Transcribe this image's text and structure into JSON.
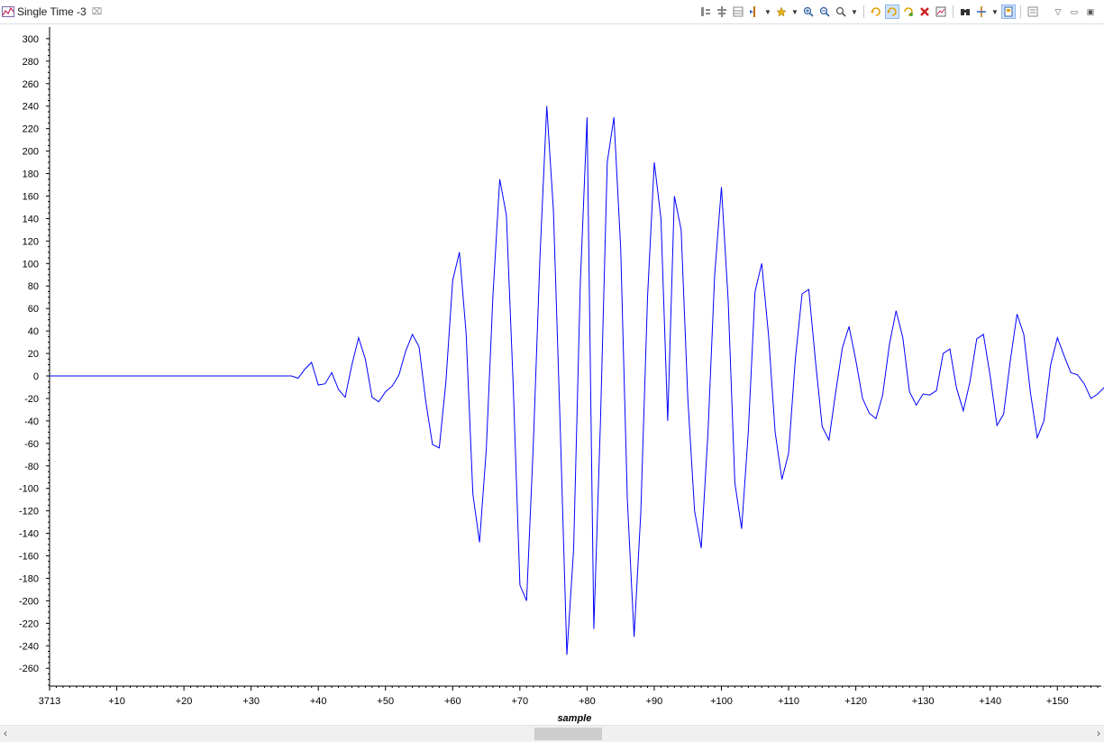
{
  "tab": {
    "title": "Single Time -3",
    "close_glyph": "⌧"
  },
  "toolbar": {
    "icons": [
      "graph-align-icon",
      "graph-center-icon",
      "graph-table-icon",
      "marker-icon",
      "dropdown",
      "star-icon",
      "dropdown",
      "zoom-in-icon",
      "zoom-out-icon",
      "zoom-fit-icon",
      "dropdown",
      "sep",
      "refresh-icon",
      "refresh-auto-icon",
      "continuous-refresh-icon",
      "delete-icon",
      "image-icon",
      "sep",
      "find-icon",
      "settings-icon",
      "dropdown",
      "pin-icon",
      "sep",
      "properties-icon"
    ],
    "window_controls": [
      "▽",
      "▭",
      "▣"
    ]
  },
  "scrollbar": {
    "left": "‹",
    "right": "›"
  },
  "colors": {
    "line": "#0000ff",
    "axis": "#000000"
  },
  "chart_data": {
    "type": "line",
    "xlabel": "sample",
    "ylabel": "",
    "x_start": 0,
    "xlim": [
      0,
      157
    ],
    "ylim": [
      -275,
      310
    ],
    "x_tick_values": [
      0,
      10,
      20,
      30,
      40,
      50,
      60,
      70,
      80,
      90,
      100,
      110,
      120,
      130,
      140,
      150
    ],
    "x_tick_labels": [
      "3713",
      "+10",
      "+20",
      "+30",
      "+40",
      "+50",
      "+60",
      "+70",
      "+80",
      "+90",
      "+100",
      "+110",
      "+120",
      "+130",
      "+140",
      "+150"
    ],
    "y_ticks": [
      300,
      280,
      260,
      240,
      220,
      200,
      180,
      160,
      140,
      120,
      100,
      80,
      60,
      40,
      20,
      0,
      -20,
      -40,
      -60,
      -80,
      -100,
      -120,
      -140,
      -160,
      -180,
      -200,
      -220,
      -240,
      -260
    ],
    "series": [
      {
        "x": [
          0,
          36,
          37,
          38,
          39,
          40,
          41,
          42,
          43,
          44,
          45,
          46,
          47,
          48,
          49,
          50,
          51,
          52,
          53,
          54,
          55,
          56,
          57,
          58,
          59,
          60,
          61,
          62,
          63,
          64,
          65,
          66,
          67,
          68,
          69,
          70,
          71,
          72,
          73,
          74,
          75,
          76,
          77,
          78,
          79,
          80,
          81,
          82,
          83,
          84,
          85,
          86,
          87,
          88,
          89,
          90,
          91,
          92,
          93,
          94,
          95,
          96,
          97,
          98,
          99,
          100,
          101,
          102,
          103,
          104,
          105,
          106,
          107,
          108,
          109,
          110,
          111,
          112,
          113,
          114,
          115,
          116,
          117,
          118,
          119,
          120,
          121,
          122,
          123,
          124,
          125,
          126,
          127,
          128,
          129,
          130,
          131,
          132,
          133,
          134,
          135,
          136,
          137,
          138,
          139,
          140,
          141,
          142,
          143,
          144,
          145,
          146,
          147,
          148,
          149,
          150,
          151,
          152,
          153,
          154,
          155,
          156,
          157
        ],
        "values": [
          0,
          0,
          -2,
          6,
          12,
          -8,
          -7,
          3,
          -12,
          -19,
          10,
          34,
          15,
          -19,
          -23,
          -14,
          -9,
          1,
          22,
          37,
          26,
          -23,
          -61,
          -64,
          -5,
          85,
          110,
          38,
          -105,
          -148,
          -65,
          72,
          175,
          143,
          -7,
          -186,
          -200,
          -60,
          107,
          240,
          147,
          -45,
          -248,
          -154,
          82,
          230,
          -225,
          -40,
          190,
          230,
          114,
          -110,
          -232,
          -122,
          70,
          190,
          140,
          -40,
          160,
          130,
          -20,
          -120,
          -153,
          -50,
          90,
          168,
          67,
          -95,
          -136,
          -50,
          75,
          100,
          37,
          -50,
          -92,
          -69,
          15,
          73,
          77,
          13,
          -45,
          -57,
          -15,
          25,
          44,
          14,
          -20,
          -33,
          -38,
          -17,
          28,
          58,
          34,
          -14,
          -26,
          -16,
          -17,
          -13,
          20,
          24,
          -11,
          -31,
          -5,
          33,
          37,
          0,
          -44,
          -34,
          14,
          55,
          37,
          -15,
          -55,
          -40,
          10,
          34,
          18,
          3,
          1,
          -7,
          -20,
          -16,
          -10
        ]
      }
    ]
  }
}
